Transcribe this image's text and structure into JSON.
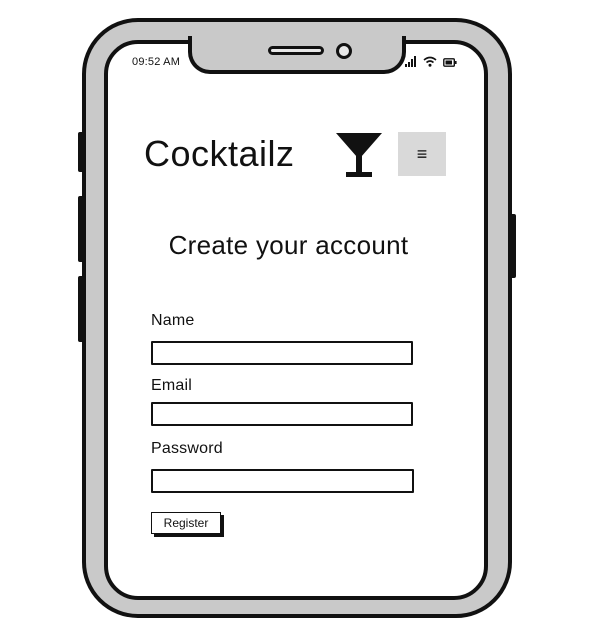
{
  "status_bar": {
    "time": "09:52 AM",
    "icons": [
      "signal-icon",
      "wifi-icon",
      "battery-icon"
    ]
  },
  "header": {
    "brand": "Cocktailz",
    "brand_icon": "cocktail-glass-icon",
    "menu_label": "≡",
    "menu_icon": "hamburger-menu-icon"
  },
  "form": {
    "title": "Create your account",
    "fields": [
      {
        "label": "Name",
        "value": "",
        "placeholder": ""
      },
      {
        "label": "Email",
        "value": "",
        "placeholder": ""
      },
      {
        "label": "Password",
        "value": "",
        "placeholder": ""
      }
    ],
    "submit_label": "Register"
  },
  "colors": {
    "frame": "#c9c9c9",
    "outline": "#111111",
    "menu_bg": "#d9d9d9"
  }
}
